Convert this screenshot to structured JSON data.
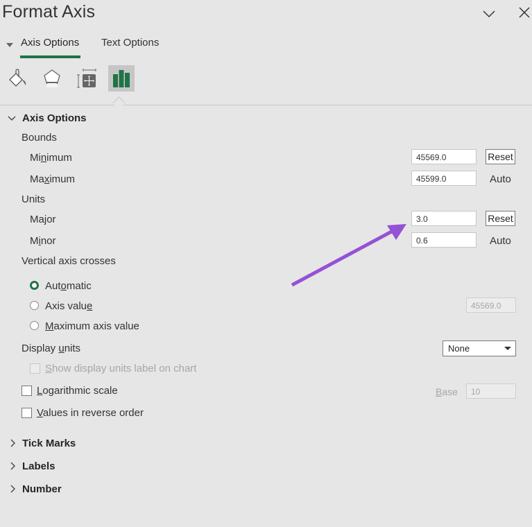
{
  "pane": {
    "title": "Format Axis",
    "header_icons": [
      "chevron-down-icon",
      "close-icon"
    ]
  },
  "tabs": [
    {
      "label": "Axis Options",
      "active": true
    },
    {
      "label": "Text Options",
      "active": false
    }
  ],
  "icon_tabs": [
    {
      "name": "fill-line-icon",
      "active": false
    },
    {
      "name": "effects-icon",
      "active": false
    },
    {
      "name": "size-properties-icon",
      "active": false
    },
    {
      "name": "axis-options-icon",
      "active": true
    }
  ],
  "axis_options": {
    "header": "Axis Options",
    "bounds": {
      "label": "Bounds",
      "minimum": {
        "label_pre": "Mi",
        "label_u": "n",
        "label_post": "imum",
        "value": "45569.0",
        "action": "Reset"
      },
      "maximum": {
        "label_pre": "Ma",
        "label_u": "x",
        "label_post": "imum",
        "value": "45599.0",
        "action": "Auto"
      }
    },
    "units": {
      "label": "Units",
      "major": {
        "label_pre": "Ma",
        "label_u": "j",
        "label_post": "or",
        "value": "3.0",
        "action": "Reset"
      },
      "minor": {
        "label_pre": "M",
        "label_u": "i",
        "label_post": "nor",
        "value": "0.6",
        "action": "Auto"
      }
    },
    "vertical_axis_crosses": {
      "label": "Vertical axis crosses",
      "options": [
        {
          "pre": "Aut",
          "u": "o",
          "post": "matic",
          "selected": true
        },
        {
          "pre": "Axis valu",
          "u": "e",
          "post": "",
          "selected": false
        },
        {
          "pre": "",
          "u": "M",
          "post": "aximum axis value",
          "selected": false
        }
      ],
      "axis_value": "45569.0"
    },
    "display_units": {
      "label_pre": "Display ",
      "label_u": "u",
      "label_post": "nits",
      "selected": "None",
      "show_label": {
        "pre": "",
        "u": "S",
        "post": "how display units label on chart",
        "checked": false,
        "disabled": true
      }
    },
    "logarithmic": {
      "pre": "",
      "u": "L",
      "post": "ogarithmic scale",
      "checked": false,
      "base_label_u": "B",
      "base_label_post": "ase",
      "base_value": "10"
    },
    "reverse_order": {
      "pre": "",
      "u": "V",
      "post": "alues in reverse order",
      "checked": false
    }
  },
  "collapsed_sections": [
    "Tick Marks",
    "Labels",
    "Number"
  ],
  "annotation": {
    "type": "arrow",
    "color": "#9452d6",
    "points_to": "major-units-field"
  }
}
